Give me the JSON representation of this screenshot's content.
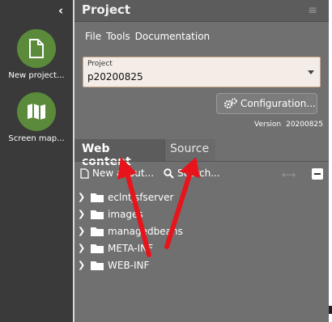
{
  "sidebar": {
    "collapse_icon": "chevron-left-icon",
    "launchers": [
      {
        "label": "New project...",
        "icon": "file-icon"
      },
      {
        "label": "Screen map...",
        "icon": "map-icon"
      }
    ],
    "accent": "#5b8a3a"
  },
  "panel": {
    "title": "Project",
    "menu": [
      "File",
      "Tools",
      "Documentation"
    ],
    "project_select": {
      "label": "Project",
      "value": "p20200825"
    },
    "config_button": "Configuration...",
    "version_label": "Version",
    "version_value": "20200825",
    "tabs": [
      {
        "label": "Web content",
        "active": true
      },
      {
        "label": "Source",
        "active": false
      }
    ],
    "toolbar": {
      "new_label": "New about...",
      "search_label": "Search..."
    },
    "tree": [
      "eclntjsfserver",
      "images",
      "managedbeans",
      "META-INF",
      "WEB-INF"
    ]
  },
  "annotation_color": "#e8141b"
}
